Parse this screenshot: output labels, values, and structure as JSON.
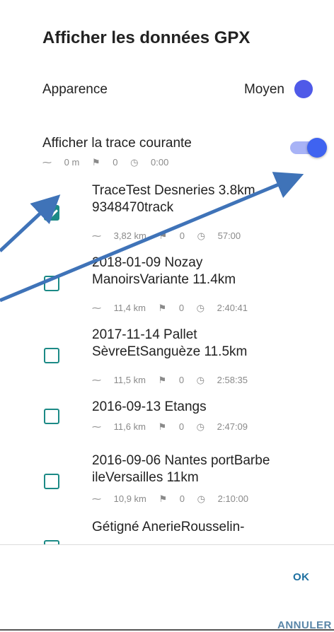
{
  "dialog": {
    "title": "Afficher les données GPX",
    "appearance": {
      "label": "Apparence",
      "value": "Moyen",
      "color": "#4f5ae8"
    },
    "current_track": {
      "label": "Afficher la trace courante",
      "toggle_on": true,
      "distance": "0 m",
      "waypoints": "0",
      "duration": "0:00"
    },
    "tracks": [
      {
        "name_line1": "TraceTest Desneries 3.8km",
        "name_line2": "9348470track",
        "distance": "3,82 km",
        "waypoints": "0",
        "duration": "57:00",
        "checked": true
      },
      {
        "name_line1": "2018-01-09 Nozay",
        "name_line2": "ManoirsVariante 11.4km",
        "distance": "11,4 km",
        "waypoints": "0",
        "duration": "2:40:41",
        "checked": false
      },
      {
        "name_line1": "2017-11-14 Pallet",
        "name_line2": "SèvreEtSanguèze 11.5km",
        "distance": "11,5 km",
        "waypoints": "0",
        "duration": "2:58:35",
        "checked": false
      },
      {
        "name_line1": "2016-09-13 Etangs",
        "name_line2": "",
        "distance": "11,6 km",
        "waypoints": "0",
        "duration": "2:47:09",
        "checked": false
      },
      {
        "name_line1": "2016-09-06 Nantes portBarbe",
        "name_line2": "ileVersailles 11km",
        "distance": "10,9 km",
        "waypoints": "0",
        "duration": "2:10:00",
        "checked": false
      },
      {
        "name_line1": "Gétigné AnerieRousselin-",
        "name_line2": "",
        "distance": "",
        "waypoints": "",
        "duration": "",
        "checked": false
      }
    ],
    "buttons": {
      "ok": "OK",
      "cancel": "ANNULER"
    },
    "accent_color": "#1c8a86",
    "annotation_arrow_color": "#3f73b8"
  }
}
